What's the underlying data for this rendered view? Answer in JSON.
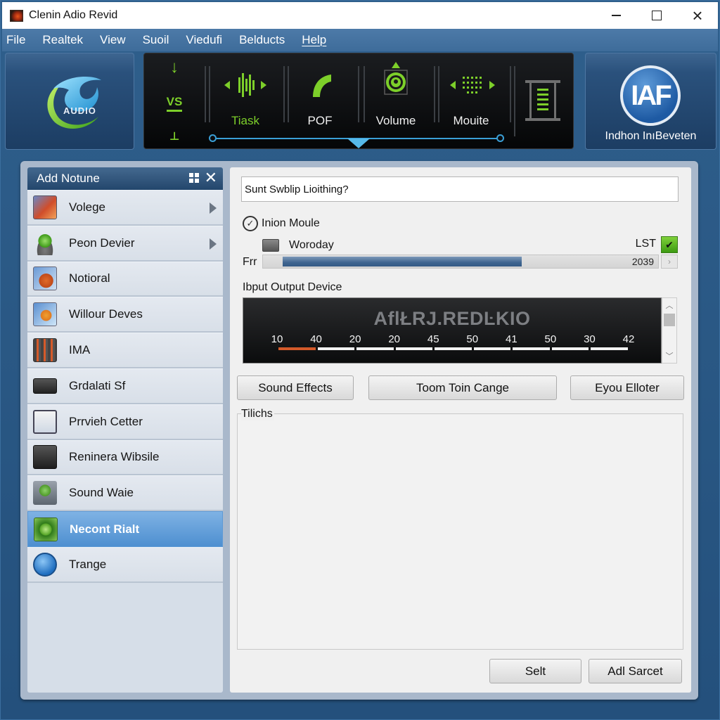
{
  "window": {
    "title": "Clenin Adio Revid",
    "controls": {
      "minimize": "minimize",
      "maximize": "maximize",
      "close": "×"
    }
  },
  "menu": {
    "items": [
      {
        "label": "File"
      },
      {
        "label": "Realtek"
      },
      {
        "label": "View"
      },
      {
        "label": "Suoil"
      },
      {
        "label": "Viedufi"
      },
      {
        "label": "Belducts"
      },
      {
        "label": "Help"
      }
    ]
  },
  "header": {
    "logo_text": "AUDIO",
    "toolbar": {
      "left_label": "VS",
      "buttons": [
        {
          "label": "Tiask",
          "icon": "waveform-icon",
          "active": true
        },
        {
          "label": "POF",
          "icon": "arc-icon",
          "active": false
        },
        {
          "label": "Volume",
          "icon": "speaker-icon",
          "active": false
        },
        {
          "label": "Mouite",
          "icon": "dot-grid-icon",
          "active": false
        }
      ],
      "slider_position": 0.5
    },
    "brand": {
      "badge": "IAF",
      "label": "Indhon InıBeveten"
    }
  },
  "sidebar": {
    "title": "Add Notune",
    "items": [
      {
        "label": "Volege",
        "icon": "volume-image-icon",
        "has_submenu": true,
        "selected": false
      },
      {
        "label": "Peon Devier",
        "icon": "device-icon",
        "has_submenu": true,
        "selected": false
      },
      {
        "label": "Notioral",
        "icon": "notional-icon",
        "has_submenu": false,
        "selected": false
      },
      {
        "label": "Willour Deves",
        "icon": "picture-icon",
        "has_submenu": false,
        "selected": false
      },
      {
        "label": "IMA",
        "icon": "mixer-icon",
        "has_submenu": false,
        "selected": false
      },
      {
        "label": "Grdalati Sf",
        "icon": "monitor-icon",
        "has_submenu": false,
        "selected": false
      },
      {
        "label": "Prrvieh Cetter",
        "icon": "preview-icon",
        "has_submenu": false,
        "selected": false
      },
      {
        "label": "Reninera Wibsile",
        "icon": "power-icon",
        "has_submenu": false,
        "selected": false
      },
      {
        "label": "Sound Waie",
        "icon": "sound-wave-icon",
        "has_submenu": false,
        "selected": false
      },
      {
        "label": "Necont Rialt",
        "icon": "network-icon",
        "has_submenu": false,
        "selected": true
      },
      {
        "label": "Trange",
        "icon": "compass-icon",
        "has_submenu": false,
        "selected": false
      }
    ]
  },
  "main": {
    "search_value": "Sunt Swblip Lioithing?",
    "module_label": "Inion Moule",
    "device_name": "Woroday",
    "device_tag": "LST",
    "progress_label": "Frr",
    "progress_value": "2039",
    "progress_fraction": 0.65,
    "section_label": "Ibput Output Device",
    "meter": {
      "brand": "AflŁRJ.REDĿKIO",
      "scale_labels": [
        "10",
        "40",
        "20",
        "20",
        "45",
        "50",
        "41",
        "50",
        "30",
        "42"
      ],
      "hot_segments": 1
    },
    "buttons": {
      "sound_effects": "Sound Effects",
      "toom_toin": "Toom Toin Cange",
      "eyou_elloter": "Eyou Elloter"
    },
    "group_label": "Tilichs",
    "footer": {
      "selt": "Selt",
      "add_sarcet": "Adl Sarcet"
    }
  },
  "colors": {
    "accent_green": "#7dcf2a",
    "accent_blue": "#3a9fd6",
    "selection": "#4e8fd0",
    "meter_hot": "#d45a2a"
  }
}
